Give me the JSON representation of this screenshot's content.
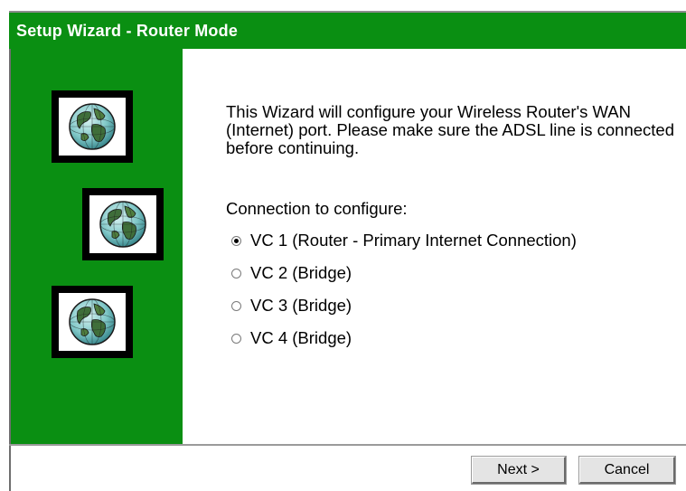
{
  "window": {
    "title": "Setup Wizard - Router Mode"
  },
  "sidebar": {
    "icons": [
      "globe-icon",
      "globe-icon",
      "globe-icon"
    ]
  },
  "main": {
    "description": "This Wizard will configure your Wireless Router's WAN (Internet) port. Please make sure the ADSL line is connected before continuing.",
    "connection_label": "Connection to configure:",
    "options": [
      {
        "label": "VC 1 (Router - Primary Internet Connection)",
        "selected": true
      },
      {
        "label": "VC 2 (Bridge)",
        "selected": false
      },
      {
        "label": "VC 3 (Bridge)",
        "selected": false
      },
      {
        "label": "VC 4 (Bridge)",
        "selected": false
      }
    ]
  },
  "footer": {
    "next_label": "Next >",
    "cancel_label": "Cancel"
  },
  "colors": {
    "accent": "#0a8f12",
    "title_text": "#ffffff"
  }
}
